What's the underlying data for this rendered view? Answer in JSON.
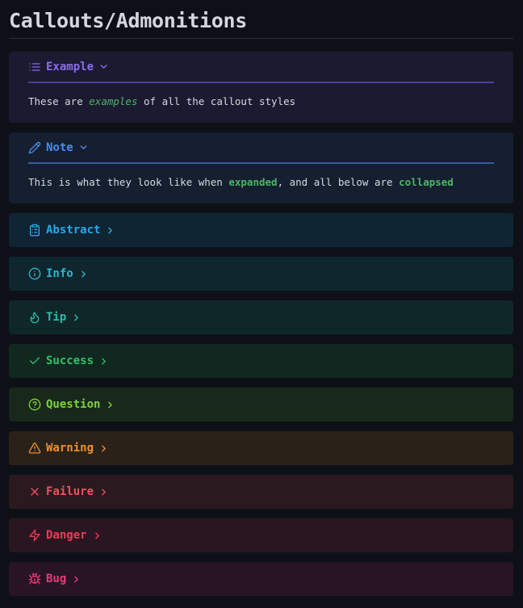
{
  "page": {
    "title": "Callouts/Admonitions"
  },
  "callouts": [
    {
      "key": "example",
      "label": "Example",
      "state": "expanded",
      "icon": "list-icon",
      "color": "#8b6cf0",
      "bg": "#1c1a30",
      "line": "#4a3fa0",
      "body": {
        "pre": "These are ",
        "em": "examples",
        "post": " of all the callout styles"
      }
    },
    {
      "key": "note",
      "label": "Note",
      "state": "expanded",
      "icon": "pencil-icon",
      "color": "#4a8cf0",
      "bg": "#151f30",
      "line": "#3a5aa0",
      "body": {
        "pre": "This is what they look like when ",
        "strong1": "expanded",
        "mid": ", and all below are ",
        "strong2": "collapsed"
      }
    },
    {
      "key": "abstract",
      "label": "Abstract",
      "state": "collapsed",
      "icon": "clipboard-icon",
      "color": "#28a8e8",
      "bg": "#0f2533"
    },
    {
      "key": "info",
      "label": "Info",
      "state": "collapsed",
      "icon": "info-icon",
      "color": "#2cb6cc",
      "bg": "#0f262e"
    },
    {
      "key": "tip",
      "label": "Tip",
      "state": "collapsed",
      "icon": "flame-icon",
      "color": "#2cbba8",
      "bg": "#10272a"
    },
    {
      "key": "success",
      "label": "Success",
      "state": "collapsed",
      "icon": "check-icon",
      "color": "#36c06a",
      "bg": "#102820"
    },
    {
      "key": "question",
      "label": "Question",
      "state": "collapsed",
      "icon": "help-circle-icon",
      "color": "#7ed43a",
      "bg": "#18281a"
    },
    {
      "key": "warning",
      "label": "Warning",
      "state": "collapsed",
      "icon": "alert-triangle-icon",
      "color": "#f0902a",
      "bg": "#2a2219"
    },
    {
      "key": "failure",
      "label": "Failure",
      "state": "collapsed",
      "icon": "x-icon",
      "color": "#f05060",
      "bg": "#2a1a1f"
    },
    {
      "key": "danger",
      "label": "Danger",
      "state": "collapsed",
      "icon": "zap-icon",
      "color": "#f03a58",
      "bg": "#2a1620"
    },
    {
      "key": "bug",
      "label": "Bug",
      "state": "collapsed",
      "icon": "bug-icon",
      "color": "#e83a78",
      "bg": "#291426"
    }
  ]
}
